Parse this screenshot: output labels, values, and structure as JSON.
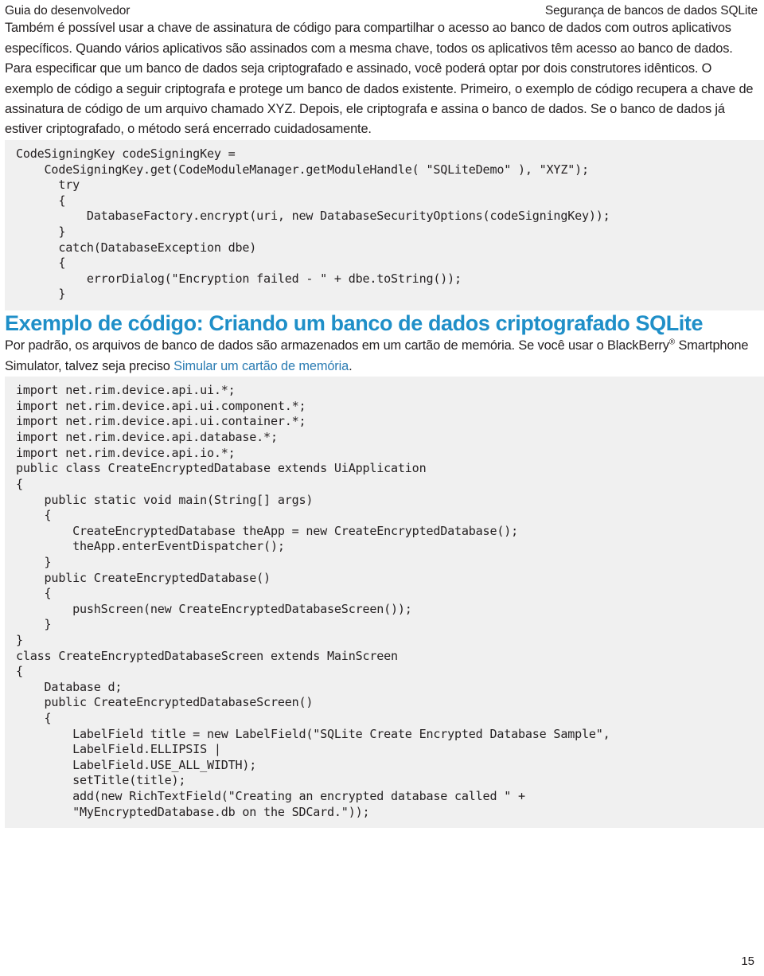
{
  "document": {
    "header": {
      "left": "Guia do desenvolvedor",
      "right": "Segurança de bancos de dados SQLite"
    },
    "footer": {
      "page_number": "15"
    },
    "paragraphs": {
      "p1": "Também é possível usar a chave de assinatura de código para compartilhar o acesso ao banco de dados com outros aplicativos específicos. Quando vários aplicativos são assinados com a mesma chave, todos os aplicativos têm acesso ao banco de dados.",
      "p2": "Para especificar que um banco de dados seja criptografado e assinado, você poderá optar por dois construtores idênticos. O exemplo de código a seguir criptografa e protege um banco de dados existente. Primeiro, o exemplo de código recupera a chave de assinatura de código de um arquivo chamado XYZ. Depois, ele criptografa e assina o banco de dados. Se o banco de dados já estiver criptografado, o método será encerrado cuidadosamente.",
      "p3_part1": "Por padrão, os arquivos de banco de dados são armazenados em um cartão de memória. Se você usar o BlackBerry",
      "p3_reg": "®",
      "p3_part2": " Smartphone Simulator, talvez seja preciso ",
      "p3_link": "Simular um cartão de memória",
      "p3_part3": "."
    },
    "heading": {
      "section_title": "Exemplo de código: Criando um banco de dados criptografado SQLite"
    },
    "code_blocks": {
      "block1": "CodeSigningKey codeSigningKey =\n    CodeSigningKey.get(CodeModuleManager.getModuleHandle( \"SQLiteDemo\" ), \"XYZ\");\n      try\n      {\n          DatabaseFactory.encrypt(uri, new DatabaseSecurityOptions(codeSigningKey));\n      }\n      catch(DatabaseException dbe)\n      {\n          errorDialog(\"Encryption failed - \" + dbe.toString());\n      }",
      "block2": "import net.rim.device.api.ui.*;\nimport net.rim.device.api.ui.component.*;\nimport net.rim.device.api.ui.container.*;\nimport net.rim.device.api.database.*;\nimport net.rim.device.api.io.*;\npublic class CreateEncryptedDatabase extends UiApplication\n{\n    public static void main(String[] args)\n    {\n        CreateEncryptedDatabase theApp = new CreateEncryptedDatabase();\n        theApp.enterEventDispatcher();\n    }\n    public CreateEncryptedDatabase()\n    {\n        pushScreen(new CreateEncryptedDatabaseScreen());\n    }\n}\nclass CreateEncryptedDatabaseScreen extends MainScreen\n{\n    Database d;\n    public CreateEncryptedDatabaseScreen()\n    {\n        LabelField title = new LabelField(\"SQLite Create Encrypted Database Sample\",\n        LabelField.ELLIPSIS |\n        LabelField.USE_ALL_WIDTH);\n        setTitle(title);\n        add(new RichTextField(\"Creating an encrypted database called \" +\n        \"MyEncryptedDatabase.db on the SDCard.\"));"
    },
    "colors": {
      "heading_blue": "#1f8fc8",
      "link_blue": "#2b7cb3",
      "code_background": "#f0f0f0",
      "text": "#231f20"
    }
  }
}
